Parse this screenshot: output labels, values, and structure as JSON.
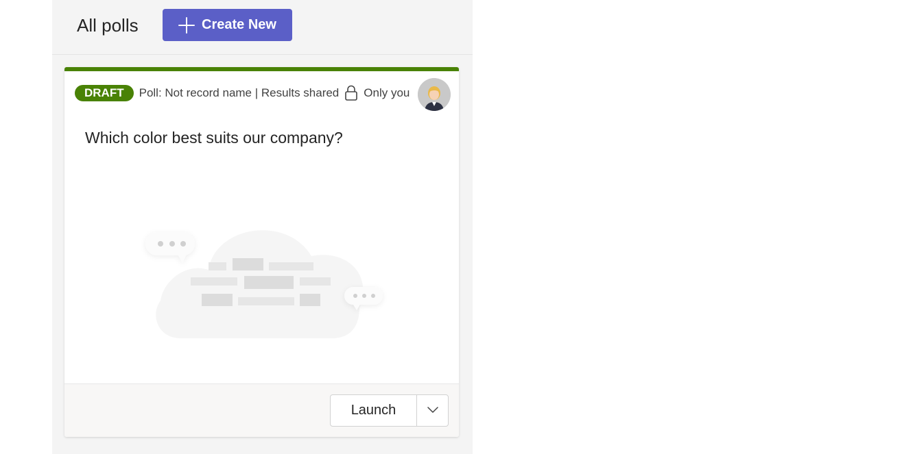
{
  "header": {
    "title": "All polls",
    "create_label": "Create New"
  },
  "colors": {
    "accent": "#5b5fc7",
    "draft_green": "#498205"
  },
  "card": {
    "status_badge": "DRAFT",
    "meta": "Poll: Not record name | Results shared",
    "visibility": "Only you",
    "question": "Which color best suits our company?",
    "launch_label": "Launch",
    "icons": [
      "plus-icon",
      "lock-icon",
      "chevron-down-icon",
      "avatar",
      "empty-state-illustration"
    ]
  }
}
